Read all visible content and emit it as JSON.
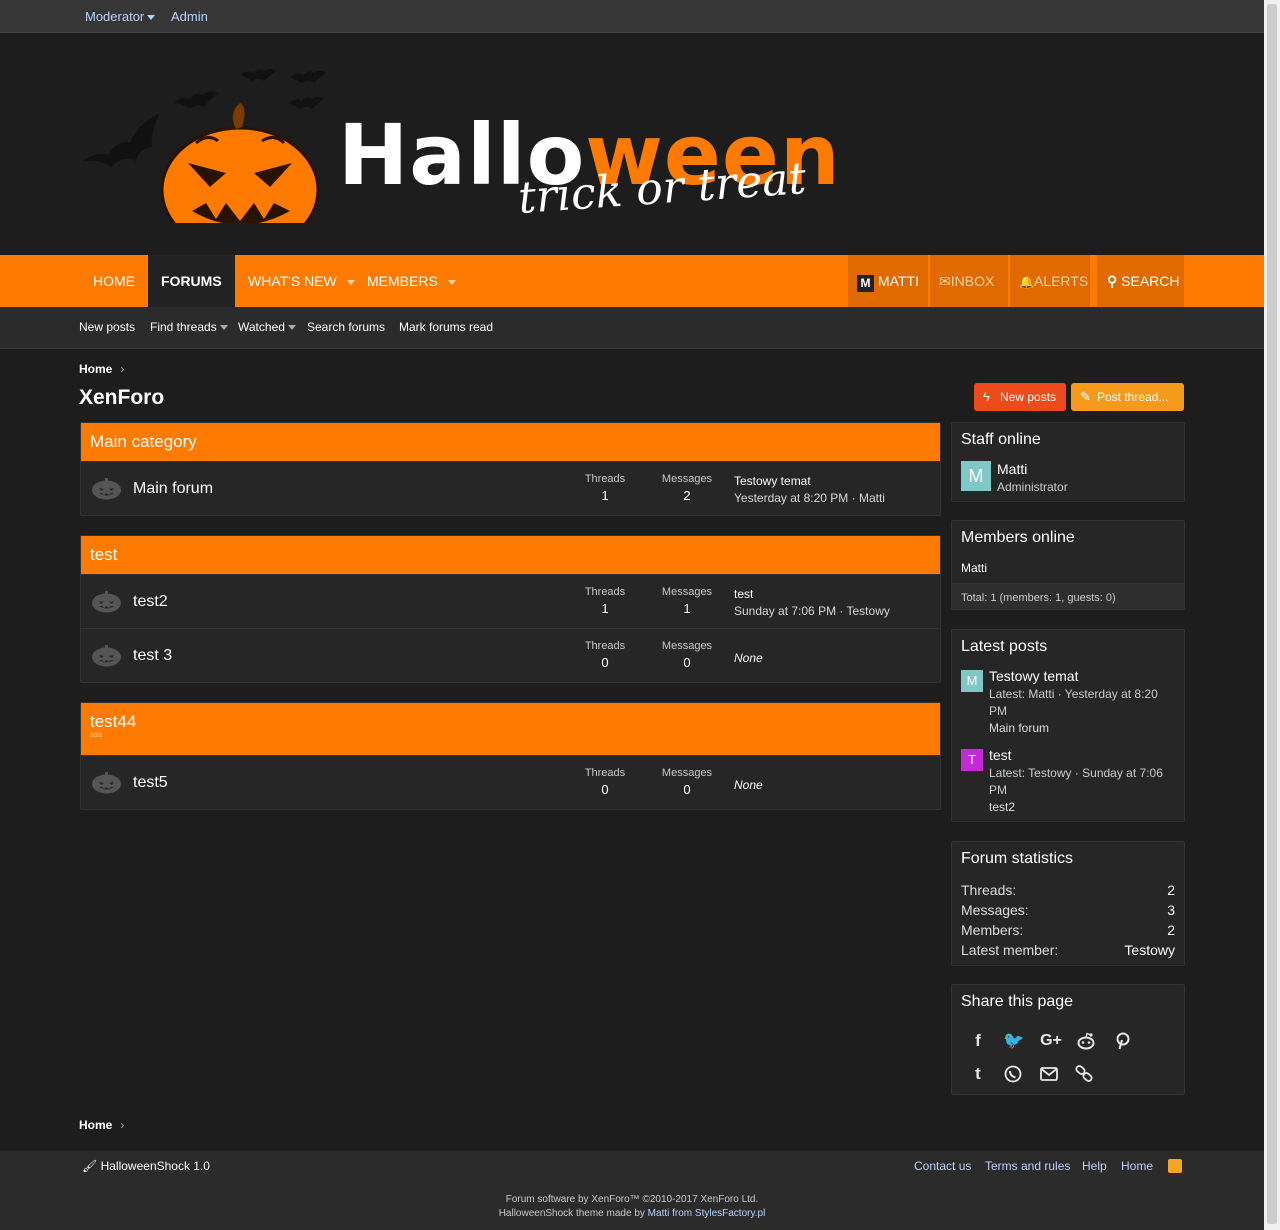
{
  "staffbar": {
    "moderator": "Moderator",
    "admin": "Admin"
  },
  "logo": {
    "title_white": "Hallo",
    "title_orange": "ween",
    "subtitle": "trick or treat"
  },
  "nav": {
    "home": "HOME",
    "forums": "FORUMS",
    "whats_new": "WHAT'S NEW",
    "members": "MEMBERS",
    "user": "MATTI",
    "user_initial": "M",
    "inbox": "INBOX",
    "alerts": "ALERTS",
    "search": "SEARCH"
  },
  "subnav": {
    "new_posts": "New posts",
    "find_threads": "Find threads",
    "watched": "Watched",
    "search_forums": "Search forums",
    "mark_read": "Mark forums read"
  },
  "breadcrumb": {
    "home": "Home"
  },
  "page_title": "XenForo",
  "actions": {
    "new_posts": "New posts",
    "post_thread": "Post thread..."
  },
  "labels": {
    "threads": "Threads",
    "messages": "Messages",
    "none": "None"
  },
  "categories": [
    {
      "title": "Main category",
      "description": "",
      "forums": [
        {
          "title": "Main forum",
          "threads": "1",
          "messages": "2",
          "last_title": "Testowy temat",
          "last_meta": "Yesterday at 8:20 PM · Matti"
        }
      ]
    },
    {
      "title": "test",
      "description": "",
      "forums": [
        {
          "title": "test2",
          "threads": "1",
          "messages": "1",
          "last_title": "test",
          "last_meta": "Sunday at 7:06 PM · Testowy"
        },
        {
          "title": "test 3",
          "threads": "0",
          "messages": "0",
          "last_title": "",
          "last_meta": ""
        }
      ]
    },
    {
      "title": "test44",
      "description": "sss",
      "forums": [
        {
          "title": "test5",
          "threads": "0",
          "messages": "0",
          "last_title": "",
          "last_meta": ""
        }
      ]
    }
  ],
  "staff_online": {
    "title": "Staff online",
    "name": "Matti",
    "role": "Administrator",
    "initial": "M"
  },
  "members_online": {
    "title": "Members online",
    "list": "Matti",
    "total": "Total: 1 (members: 1, guests: 0)"
  },
  "latest_posts": {
    "title": "Latest posts",
    "items": [
      {
        "initial": "M",
        "title": "Testowy temat",
        "meta1": "Latest: Matti · Yesterday at 8:20",
        "meta2": "PM",
        "forum": "Main forum",
        "color": "#7fc8c8"
      },
      {
        "initial": "T",
        "title": "test",
        "meta1": "Latest: Testowy · Sunday at 7:06",
        "meta2": "PM",
        "forum": "test2",
        "color": "#c52ad8"
      }
    ]
  },
  "forum_statistics": {
    "title": "Forum statistics",
    "rows": [
      {
        "label": "Threads:",
        "value": "2"
      },
      {
        "label": "Messages:",
        "value": "3"
      },
      {
        "label": "Members:",
        "value": "2"
      },
      {
        "label": "Latest member:",
        "value": "Testowy"
      }
    ]
  },
  "share": {
    "title": "Share this page",
    "icons": [
      "facebook-icon",
      "twitter-icon",
      "google-plus-icon",
      "reddit-icon",
      "pinterest-icon",
      "tumblr-icon",
      "whatsapp-icon",
      "email-icon",
      "link-icon"
    ]
  },
  "footer": {
    "style": "HalloweenShock 1.0",
    "contact": "Contact us",
    "terms": "Terms and rules",
    "help": "Help",
    "home": "Home",
    "copyright": "Forum software by XenForo™ ©2010-2017 XenForo Ltd.",
    "theme_prefix": "HalloweenShock theme made by ",
    "theme_link": "Matti from StylesFactory.pl"
  },
  "colors": {
    "accent": "#ff7a00",
    "background": "#1d1d1d",
    "panel": "#262626",
    "link": "#b8d3ff"
  }
}
